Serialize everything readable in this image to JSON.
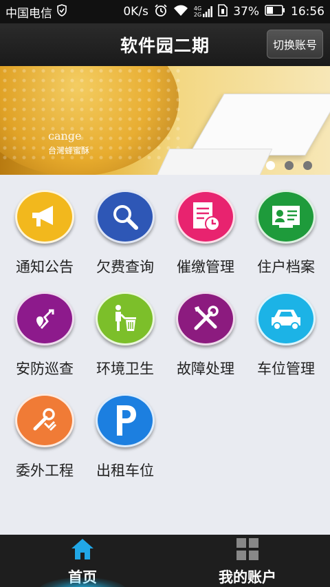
{
  "status_bar": {
    "carrier": "中国电信",
    "speed": "0K/s",
    "network_top": "4G",
    "network_bottom": "2G",
    "battery": "37%",
    "time": "16:56"
  },
  "header": {
    "title": "软件园二期",
    "switch_account_label": "切换账号"
  },
  "banner": {
    "brand_logo": "cange",
    "brand_name": "台灣蜂蜜酥",
    "active_index": 0,
    "dot_count": 3
  },
  "grid_items": [
    {
      "label": "通知公告",
      "icon": "megaphone-icon",
      "color": "#f2b81d"
    },
    {
      "label": "欠费查询",
      "icon": "magnifier-icon",
      "color": "#2e57b6"
    },
    {
      "label": "催缴管理",
      "icon": "document-clock-icon",
      "color": "#e8236f"
    },
    {
      "label": "住户档案",
      "icon": "resident-card-icon",
      "color": "#1e9b3b"
    },
    {
      "label": "安防巡查",
      "icon": "patrol-route-icon",
      "color": "#8d1a8c"
    },
    {
      "label": "环境卫生",
      "icon": "trash-person-icon",
      "color": "#7cbf2a"
    },
    {
      "label": "故障处理",
      "icon": "tools-icon",
      "color": "#8c1b7f"
    },
    {
      "label": "车位管理",
      "icon": "car-icon",
      "color": "#1cb3e6"
    },
    {
      "label": "委外工程",
      "icon": "wrench-shuffle-icon",
      "color": "#f07b36"
    },
    {
      "label": "出租车位",
      "icon": "parking-icon",
      "color": "#1c7fe0"
    }
  ],
  "bottom_nav": {
    "home_label": "首页",
    "account_label": "我的账户",
    "active_color": "#21a7e6"
  }
}
